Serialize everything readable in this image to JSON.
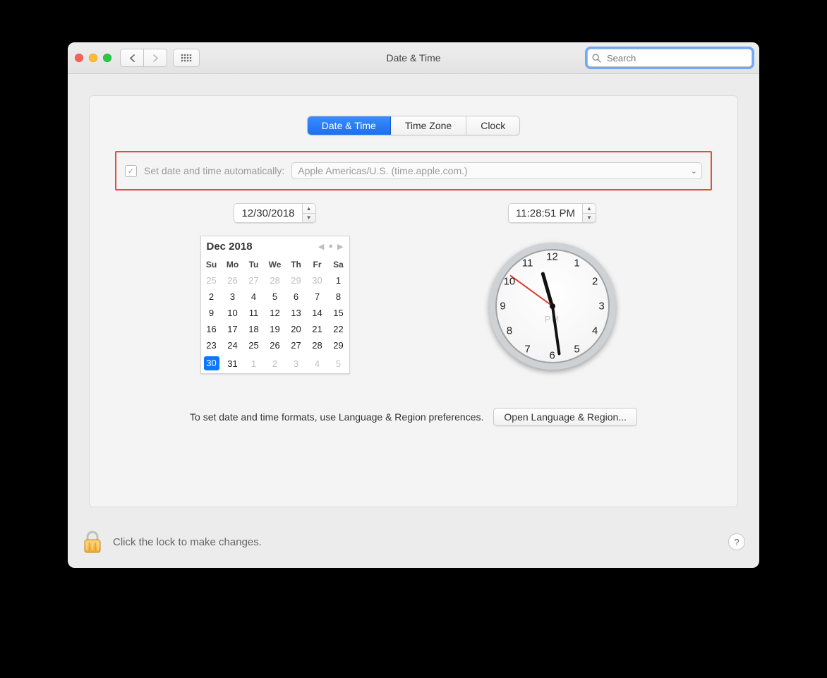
{
  "window": {
    "title": "Date & Time",
    "search_placeholder": "Search"
  },
  "tabs": {
    "date_time": "Date & Time",
    "time_zone": "Time Zone",
    "clock": "Clock"
  },
  "auto": {
    "label": "Set date and time automatically:",
    "server": "Apple Americas/U.S. (time.apple.com.)"
  },
  "date_field": "12/30/2018",
  "time_field": "11:28:51 PM",
  "calendar": {
    "month_label": "Dec 2018",
    "weekdays": [
      "Su",
      "Mo",
      "Tu",
      "We",
      "Th",
      "Fr",
      "Sa"
    ],
    "leading_other": [
      "25",
      "26",
      "27",
      "28",
      "29",
      "30"
    ],
    "days": [
      "1",
      "2",
      "3",
      "4",
      "5",
      "6",
      "7",
      "8",
      "9",
      "10",
      "11",
      "12",
      "13",
      "14",
      "15",
      "16",
      "17",
      "18",
      "19",
      "20",
      "21",
      "22",
      "23",
      "24",
      "25",
      "26",
      "27",
      "28",
      "29",
      "30",
      "31"
    ],
    "trailing_other": [
      "1",
      "2",
      "3",
      "4",
      "5"
    ],
    "selected": "30"
  },
  "clock": {
    "ampm": "PM",
    "hour_angle": 344,
    "minute_angle": 172,
    "second_angle": 306,
    "numbers": [
      "12",
      "1",
      "2",
      "3",
      "4",
      "5",
      "6",
      "7",
      "8",
      "9",
      "10",
      "11"
    ]
  },
  "footer": {
    "hint": "To set date and time formats, use Language & Region preferences.",
    "button": "Open Language & Region..."
  },
  "lock": {
    "message": "Click the lock to make changes."
  }
}
